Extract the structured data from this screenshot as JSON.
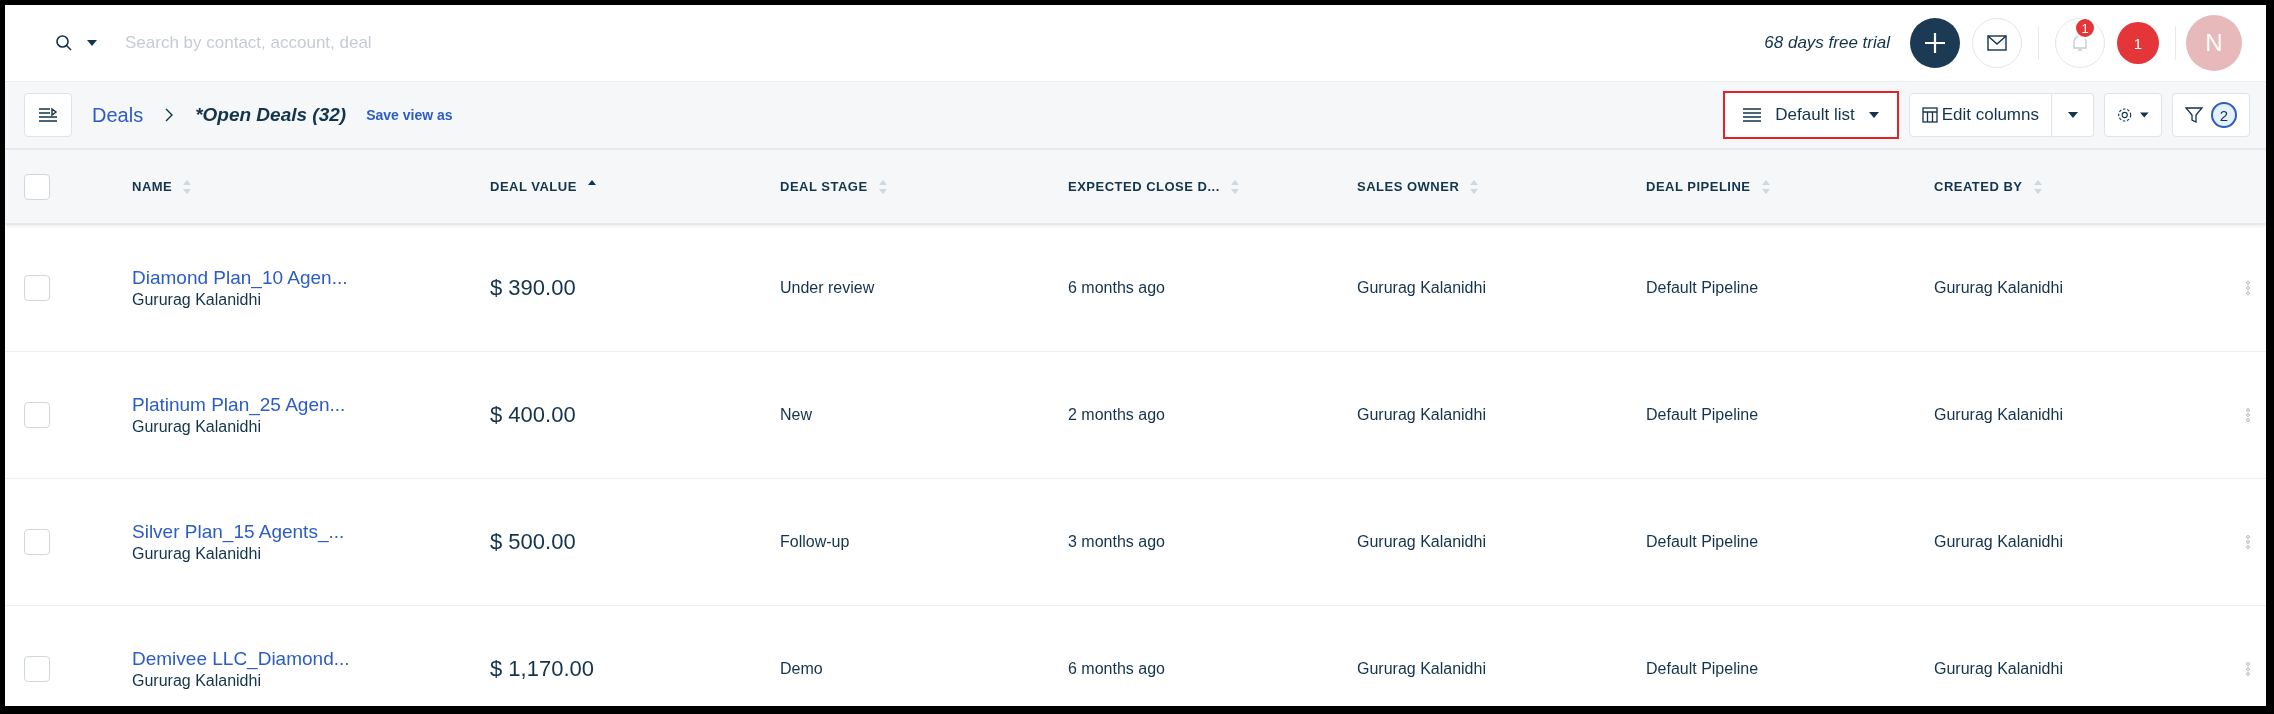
{
  "top_bar": {
    "search": {
      "placeholder": "Search by contact, account, deal"
    },
    "trial": "68 days free trial",
    "notification_count": "1",
    "alert_count": "1",
    "avatar_initial": "N"
  },
  "toolbar": {
    "breadcrumb": "Deals",
    "view_title": "*Open Deals (32)",
    "save_view": "Save view as",
    "list_button": {
      "label": "Default list",
      "highlighted": true
    },
    "edit_columns": "Edit columns",
    "filter_count": "2"
  },
  "table": {
    "select_all_checked": false,
    "columns": [
      {
        "label": "NAME",
        "sorted": false
      },
      {
        "label": "DEAL VALUE",
        "sorted": true
      },
      {
        "label": "DEAL STAGE",
        "sorted": false
      },
      {
        "label": "EXPECTED CLOSE D...",
        "sorted": false
      },
      {
        "label": "SALES OWNER",
        "sorted": false
      },
      {
        "label": "DEAL PIPELINE",
        "sorted": false
      },
      {
        "label": "CREATED BY",
        "sorted": false
      }
    ],
    "rows": [
      {
        "checked": false,
        "name": "Diamond Plan_10 Agen...",
        "contact": "Gururag Kalanidhi",
        "value": "$ 390.00",
        "stage": "Under review",
        "close": "6 months ago",
        "owner": "Gururag Kalanidhi",
        "pipeline": "Default Pipeline",
        "created_by": "Gururag Kalanidhi"
      },
      {
        "checked": false,
        "name": "Platinum Plan_25 Agen...",
        "contact": "Gururag Kalanidhi",
        "value": "$ 400.00",
        "stage": "New",
        "close": "2 months ago",
        "owner": "Gururag Kalanidhi",
        "pipeline": "Default Pipeline",
        "created_by": "Gururag Kalanidhi"
      },
      {
        "checked": false,
        "name": "Silver Plan_15 Agents_...",
        "contact": "Gururag Kalanidhi",
        "value": "$ 500.00",
        "stage": "Follow-up",
        "close": "3 months ago",
        "owner": "Gururag Kalanidhi",
        "pipeline": "Default Pipeline",
        "created_by": "Gururag Kalanidhi"
      },
      {
        "checked": false,
        "name": "Demivee LLC_Diamond...",
        "contact": "Gururag Kalanidhi",
        "value": "$ 1,170.00",
        "stage": "Demo",
        "close": "6 months ago",
        "owner": "Gururag Kalanidhi",
        "pipeline": "Default Pipeline",
        "created_by": "Gururag Kalanidhi"
      }
    ]
  }
}
